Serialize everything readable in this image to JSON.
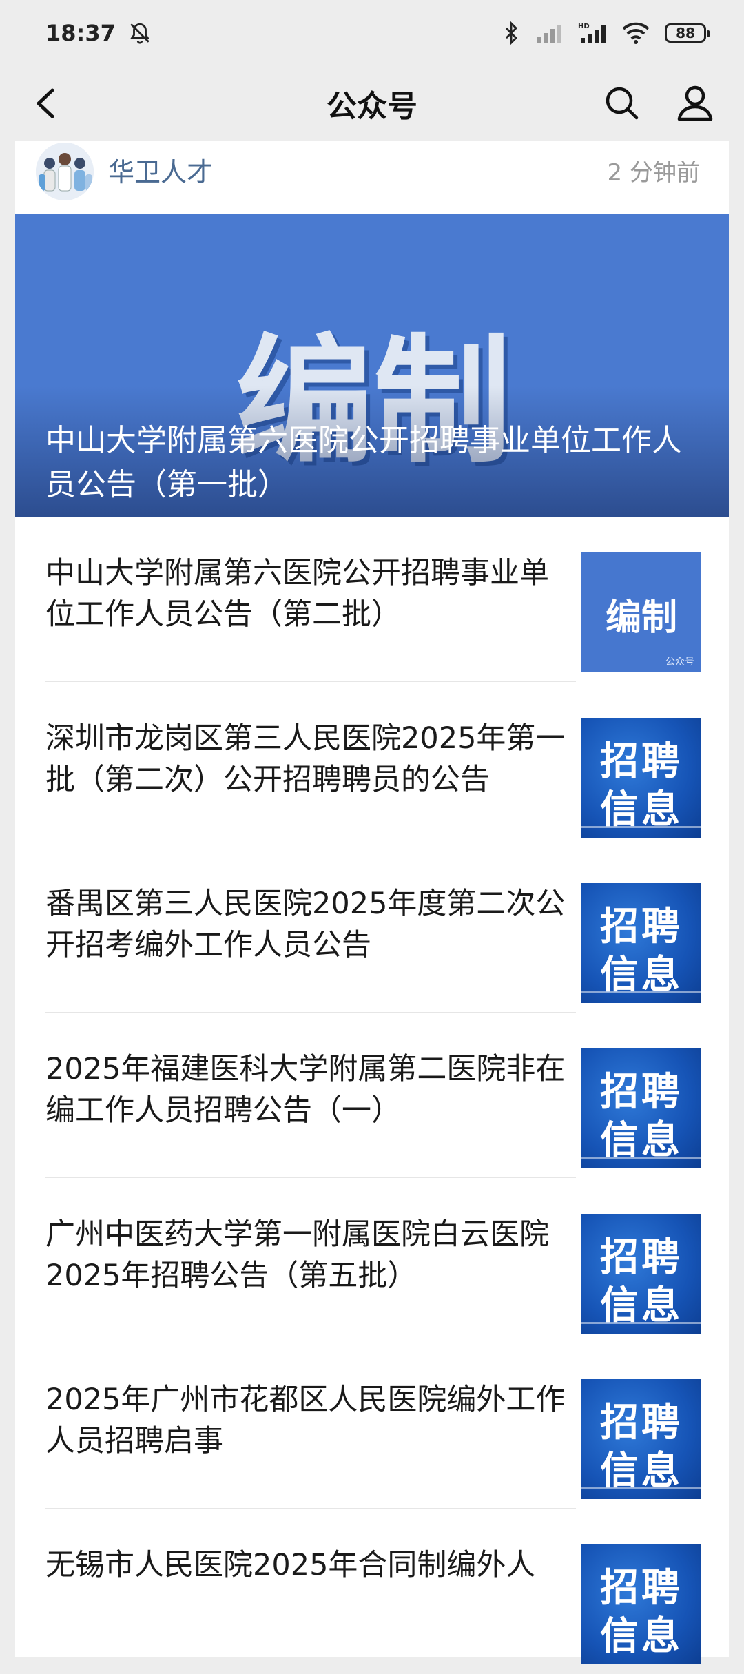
{
  "status_bar": {
    "time": "18:37",
    "battery": "88",
    "icons": [
      "bell-off-icon",
      "bluetooth-icon",
      "signal-icon",
      "hd-signal-icon",
      "wifi-icon",
      "battery-icon"
    ]
  },
  "header": {
    "title": "公众号",
    "back_icon": "chevron-left-icon",
    "search_icon": "search-icon",
    "user_icon": "user-icon"
  },
  "account": {
    "name": "华卫人才",
    "time": "2 分钟前"
  },
  "cover": {
    "image_text": "编制",
    "title": "中山大学附属第六医院公开招聘事业单位工作人员公告（第一批）"
  },
  "articles": [
    {
      "title": "中山大学附属第六医院公开招聘事业单位工作人员公告（第二批）",
      "thumb_type": "blue",
      "thumb_text": "编制",
      "thumb_mark": "公众号"
    },
    {
      "title": "深圳市龙岗区第三人民医院2025年第一批（第二次）公开招聘聘员的公告",
      "thumb_type": "recruit",
      "thumb_line1": "招聘",
      "thumb_line2": "信息"
    },
    {
      "title": "番禺区第三人民医院2025年度第二次公开招考编外工作人员公告",
      "thumb_type": "recruit",
      "thumb_line1": "招聘",
      "thumb_line2": "信息"
    },
    {
      "title": "2025年福建医科大学附属第二医院非在编工作人员招聘公告（一）",
      "thumb_type": "recruit",
      "thumb_line1": "招聘",
      "thumb_line2": "信息"
    },
    {
      "title": "广州中医药大学第一附属医院白云医院2025年招聘公告（第五批）",
      "thumb_type": "recruit",
      "thumb_line1": "招聘",
      "thumb_line2": "信息"
    },
    {
      "title": "2025年广州市花都区人民医院编外工作人员招聘启事",
      "thumb_type": "recruit",
      "thumb_line1": "招聘",
      "thumb_line2": "信息"
    },
    {
      "title": "无锡市人民医院2025年合同制编外人",
      "thumb_type": "recruit",
      "thumb_line1": "招聘",
      "thumb_line2": "信息"
    }
  ]
}
